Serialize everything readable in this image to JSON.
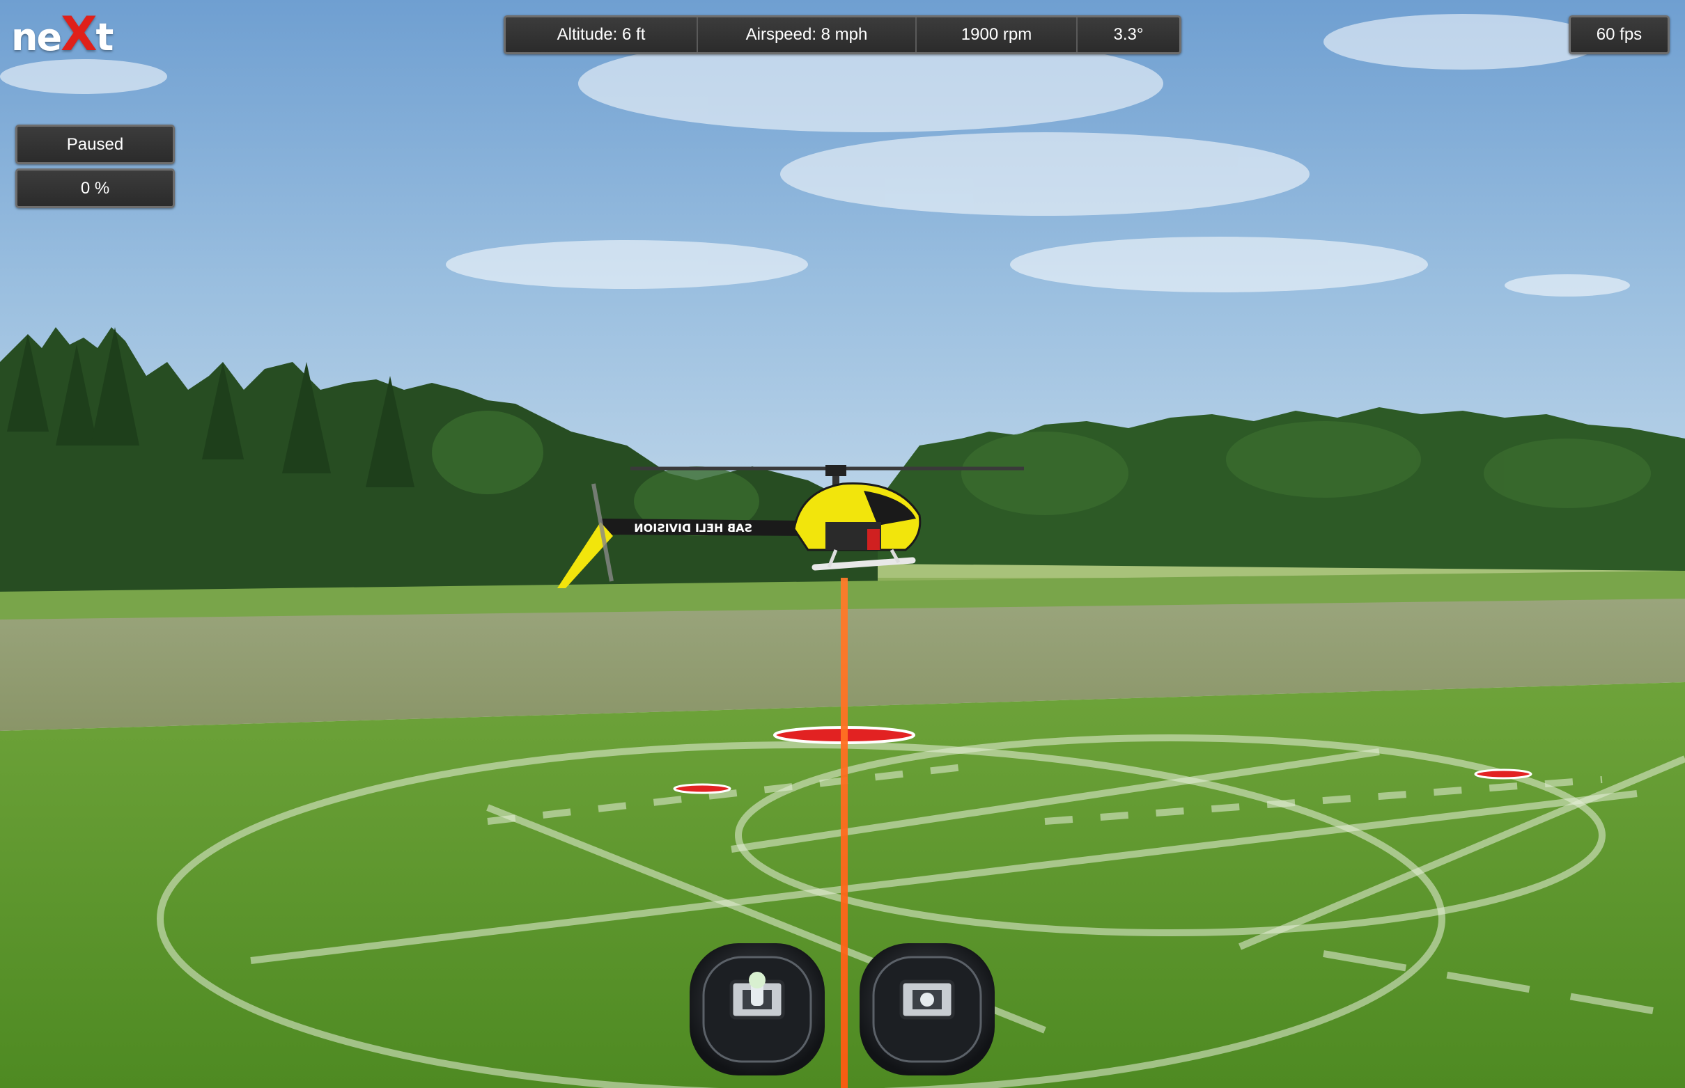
{
  "logo": {
    "prefix": "ne",
    "x": "X",
    "suffix": "t"
  },
  "telemetry": {
    "altitude": "Altitude: 6 ft",
    "airspeed": "Airspeed: 8 mph",
    "rpm": "1900 rpm",
    "pitch": "3.3°"
  },
  "fps": "60 fps",
  "status": {
    "state": "Paused",
    "progress": "0 %"
  },
  "helicopter": {
    "tail_text": "SAB HELI DIVISION"
  },
  "colors": {
    "sky": "#8db6dc",
    "grass": "#5e9a2e",
    "accent_red": "#e0201a",
    "heli_yellow": "#f2e50c",
    "laser": "#ff6a1a"
  }
}
